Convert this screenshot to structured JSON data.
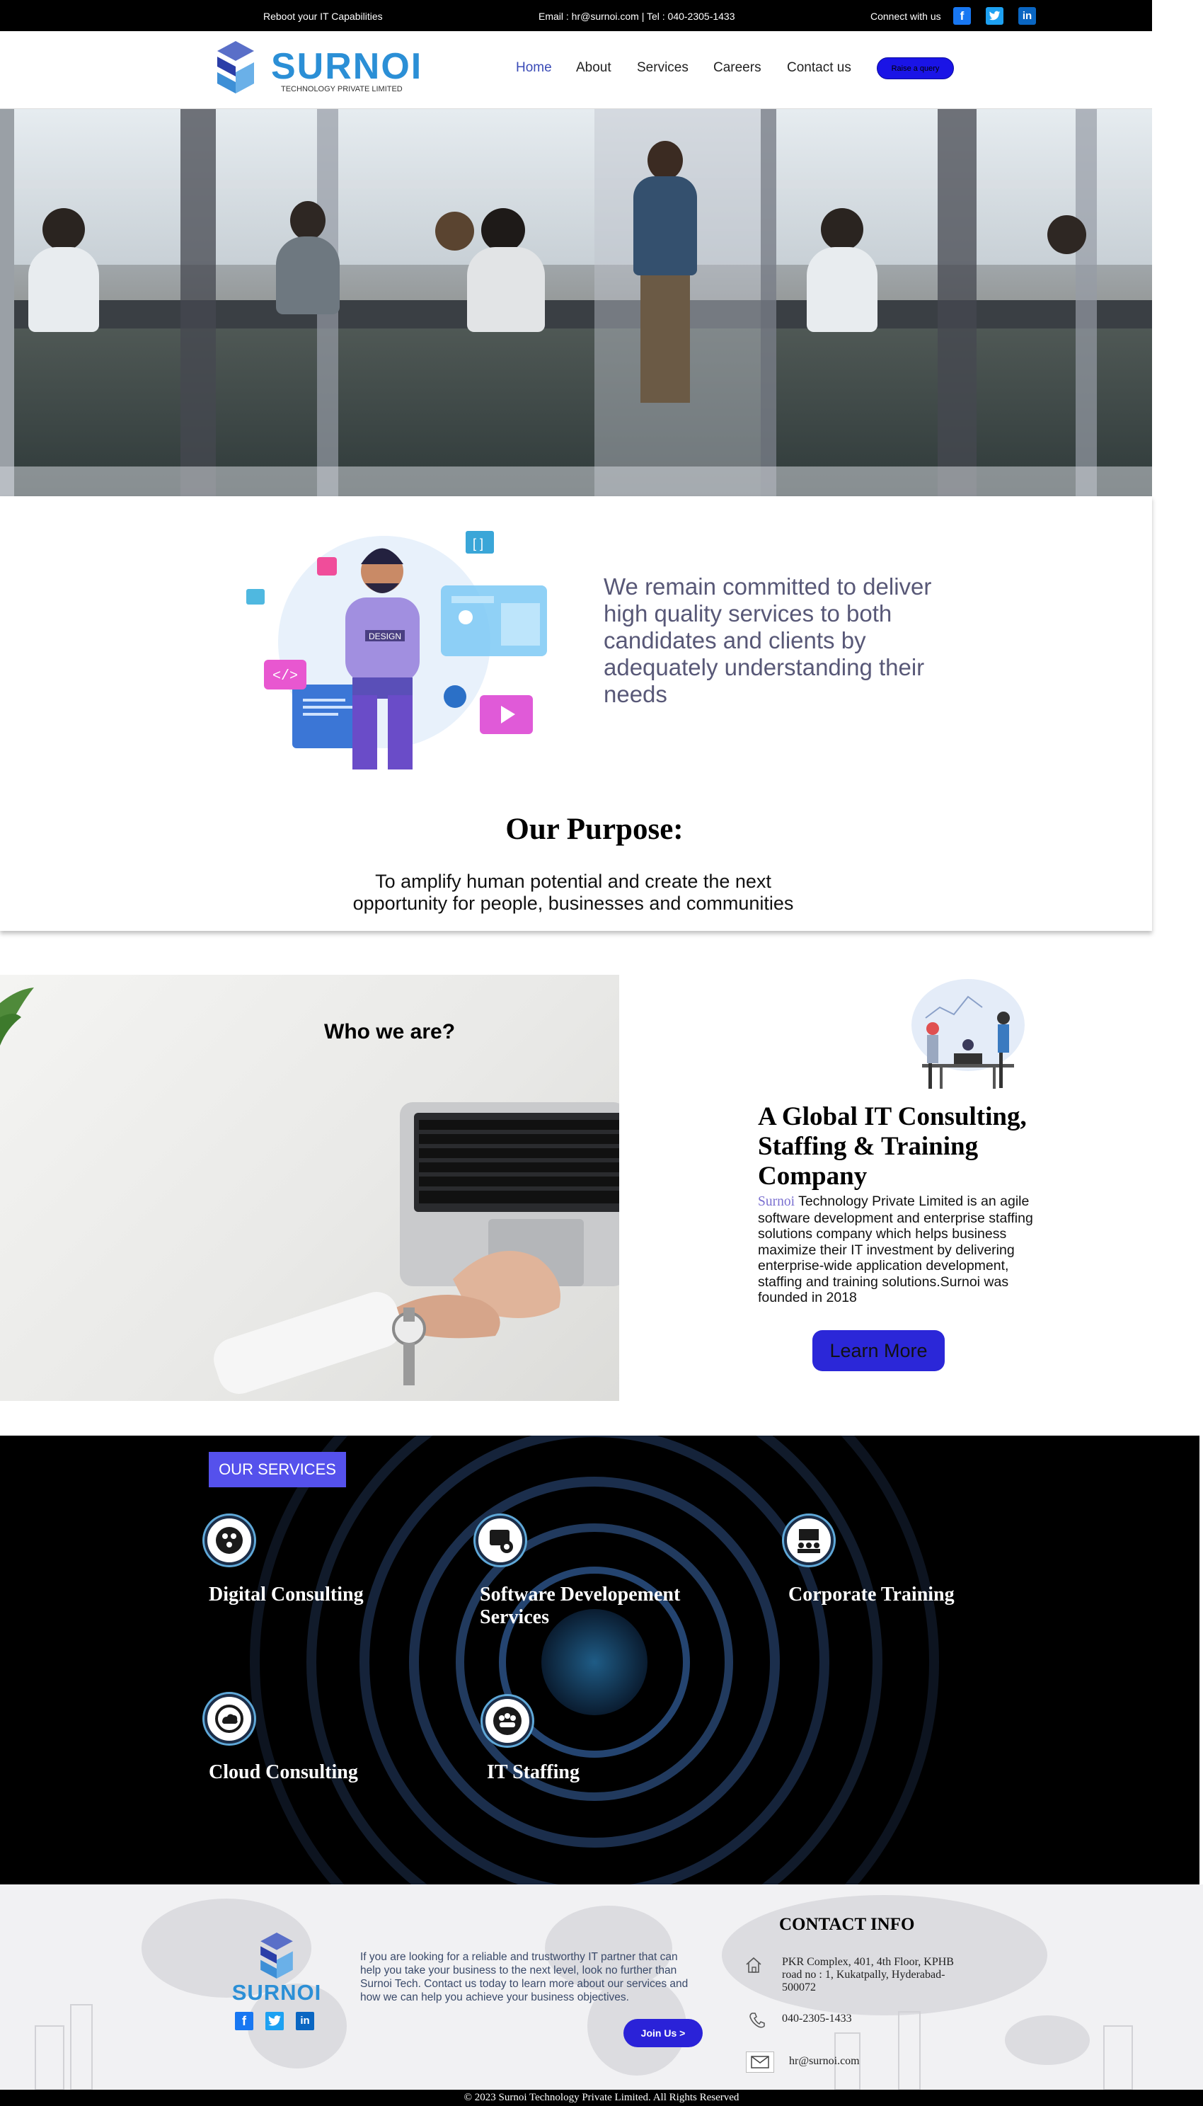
{
  "topbar": {
    "tagline": "Reboot your IT Capabilities",
    "contact": "Email : hr@surnoi.com | Tel : 040-2305-1433",
    "connect": "Connect with us",
    "social": [
      "facebook-icon",
      "twitter-icon",
      "linkedin-icon"
    ]
  },
  "brand": {
    "name": "SURNOI",
    "subtitle": "TECHNOLOGY PRIVATE LIMITED",
    "color": "#2b8fd6"
  },
  "nav": {
    "items": [
      "Home",
      "About",
      "Services",
      "Careers",
      "Contact us"
    ],
    "active": "Home",
    "button": "Raise a query"
  },
  "commitment": "We remain committed to deliver high quality services to both candidates and clients by adequately understanding their needs",
  "purpose": {
    "title": "Our Purpose:",
    "text": "To amplify human potential and create the next opportunity for people, businesses and communities"
  },
  "who": {
    "title": "Who we are?",
    "heading": "A Global IT Consulting, Staffing & Training Company",
    "brand_word": "Surnoi",
    "body": " Technology Private Limited is an agile software development and enterprise staffing solutions company which helps business maximize their IT investment by delivering enterprise-wide application development, staffing and training solutions.Surnoi was founded in 2018",
    "button": "Learn More"
  },
  "services": {
    "badge": "OUR SERVICES",
    "items": [
      {
        "title": "Digital Consulting",
        "icon": "digital-consulting-icon"
      },
      {
        "title": "Software Developement Services",
        "icon": "software-development-icon"
      },
      {
        "title": "Corporate Training",
        "icon": "corporate-training-icon"
      },
      {
        "title": "Cloud Consulting",
        "icon": "cloud-consulting-icon"
      },
      {
        "title": "IT Staffing",
        "icon": "it-staffing-icon"
      }
    ]
  },
  "footer": {
    "brand": "SURNOI",
    "text": "If you are looking for a reliable and trustworthy IT partner that can help you take your business to the next level, look no further than Surnoi Tech. Contact us today to learn more about our services and how we can help you achieve your business objectives.",
    "button": "Join Us >",
    "contact_title": "CONTACT INFO",
    "address": "PKR Complex, 401, 4th Floor, KPHB road no : 1, Kukatpally, Hyderabad-500072",
    "phone": "040-2305-1433",
    "email": "hr@surnoi.com",
    "copyright": "© 2023 Surnoi Technology Private Limited. All Rights Reserved"
  },
  "colors": {
    "accent": "#2b27d8",
    "nav_active": "#3a4bb7",
    "services_badge": "#5551ec",
    "commit_text": "#585877"
  }
}
